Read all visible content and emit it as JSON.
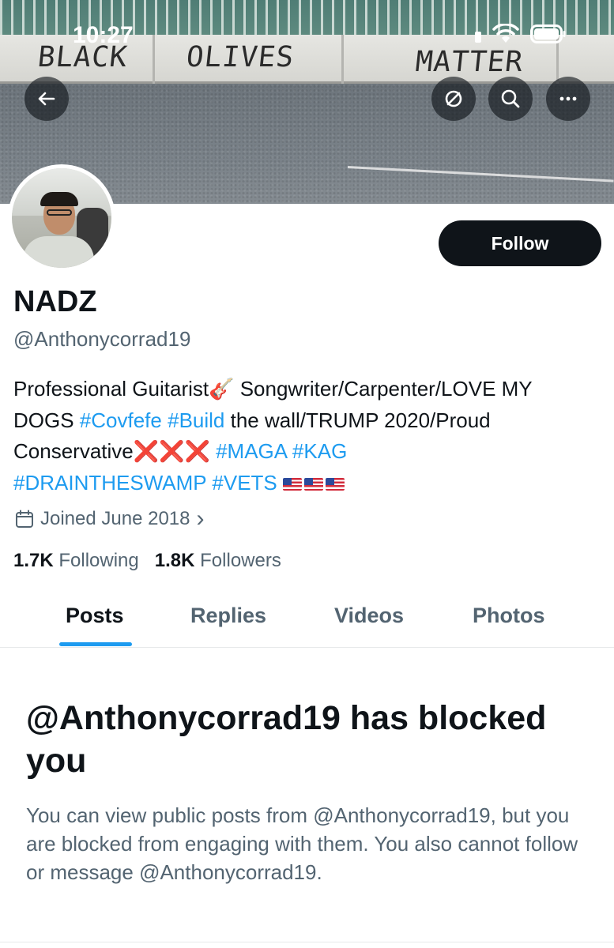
{
  "status_bar": {
    "time": "10:27",
    "icons": [
      "signal-icon",
      "wifi-icon",
      "battery-icon"
    ]
  },
  "banner": {
    "graffiti_words": [
      "BLACK",
      "OLIVES",
      "MATTER"
    ]
  },
  "header_buttons": {
    "back": "back-arrow-icon",
    "translate": "no-translate-icon",
    "search": "search-icon",
    "more": "more-icon"
  },
  "profile": {
    "display_name": "NADZ",
    "handle": "@Anthonycorrad19",
    "follow_label": "Follow",
    "bio": {
      "line1_text": "Professional Guitarist",
      "line1_emoji": "🎸",
      "line1_rest": " Songwriter/Carpenter/LOVE MY",
      "line2_prefix": "DOGS ",
      "tag_covfefe": "#Covfefe",
      "tag_build": "#Build",
      "line2_rest": " the wall/TRUMP 2020/Proud",
      "line3_text": "Conservative",
      "xmarks": "❌❌❌",
      "tag_maga": "#MAGA",
      "tag_kag": "#KAG",
      "tag_drain": "#DRAINTHESWAMP",
      "tag_vets": "#VETS",
      "flags_count": 3
    },
    "joined": "Joined June 2018",
    "joined_chevron": "›",
    "following_count": "1.7K",
    "following_label": "Following",
    "followers_count": "1.8K",
    "followers_label": "Followers"
  },
  "tabs": [
    {
      "label": "Posts",
      "active": true
    },
    {
      "label": "Replies",
      "active": false
    },
    {
      "label": "Videos",
      "active": false
    },
    {
      "label": "Photos",
      "active": false
    }
  ],
  "blocked": {
    "title": "@Anthonycorrad19 has blocked you",
    "body": "You can view public posts from @Anthonycorrad19, but you are blocked from engaging with them. You also cannot follow or message @Anthonycorrad19."
  },
  "colors": {
    "accent": "#1d9bf0",
    "text": "#0f1419",
    "muted": "#536471",
    "xmark": "#e0182d"
  }
}
